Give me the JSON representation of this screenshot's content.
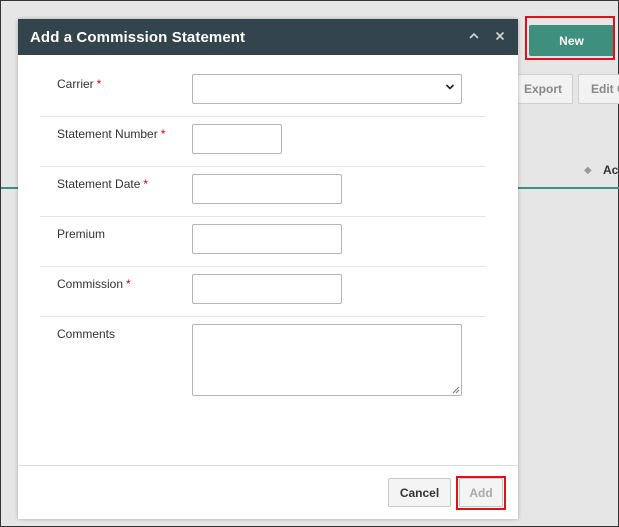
{
  "background": {
    "new_button": "New",
    "export_button": "Export",
    "edit_button": "Edit C",
    "column_header": "Ac",
    "accent_color": "#3f8f7f",
    "highlight_color": "#e0111b"
  },
  "modal": {
    "title": "Add a Commission Statement",
    "collapse_icon": "chevron-up-icon",
    "close_icon": "close-icon",
    "fields": {
      "carrier": {
        "label": "Carrier",
        "required": "*",
        "value": ""
      },
      "statement_number": {
        "label": "Statement Number",
        "required": "*",
        "value": ""
      },
      "statement_date": {
        "label": "Statement Date",
        "required": "*",
        "value": ""
      },
      "premium": {
        "label": "Premium",
        "value": ""
      },
      "commission": {
        "label": "Commission",
        "required": "*",
        "value": ""
      },
      "comments": {
        "label": "Comments",
        "value": ""
      }
    },
    "footer": {
      "cancel": "Cancel",
      "add": "Add"
    }
  }
}
